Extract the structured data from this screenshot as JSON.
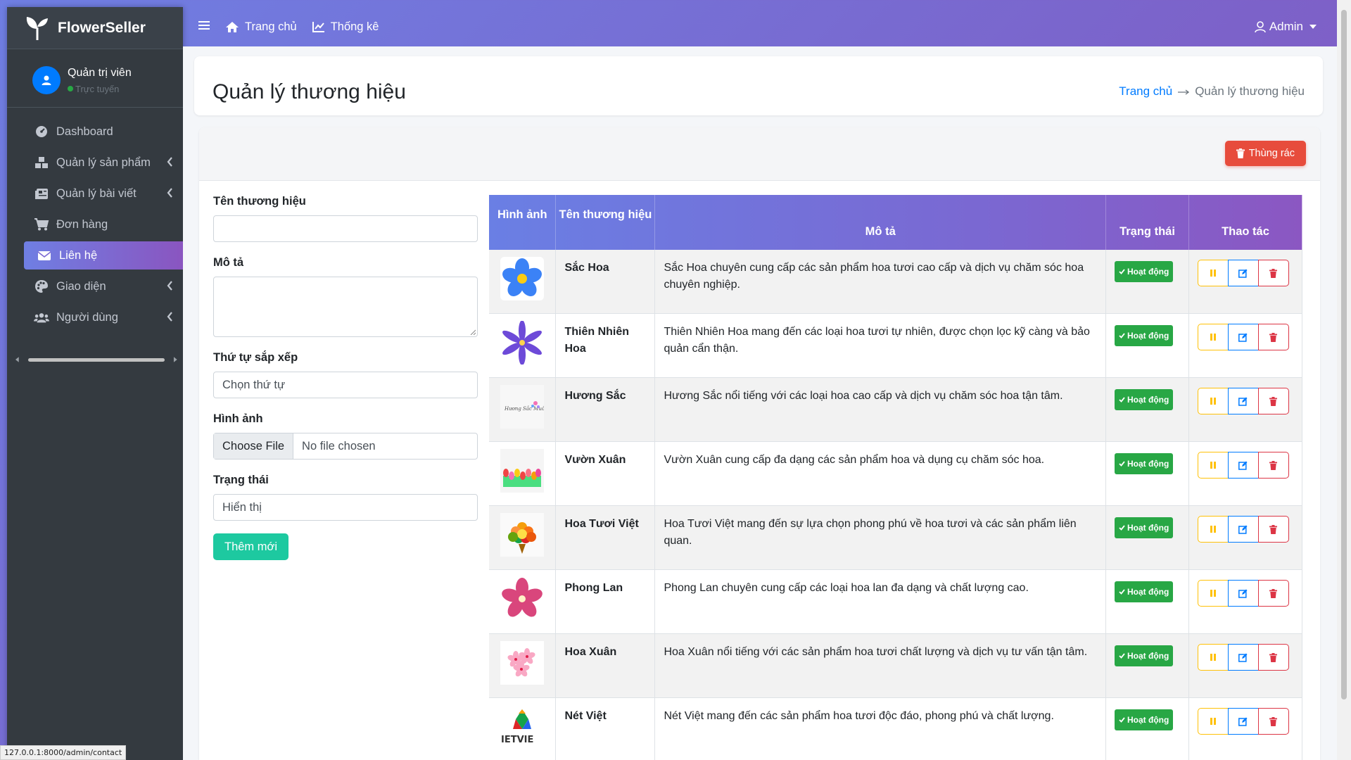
{
  "app": {
    "brand": "FlowerSeller"
  },
  "user": {
    "name": "Quản trị viên",
    "status": "Trực tuyến"
  },
  "sidebar": {
    "items": [
      {
        "label": "Dashboard"
      },
      {
        "label": "Quản lý sản phẩm"
      },
      {
        "label": "Quản lý bài viết"
      },
      {
        "label": "Đơn hàng"
      },
      {
        "label": "Liên hệ"
      },
      {
        "label": "Giao diện"
      },
      {
        "label": "Người dùng"
      }
    ]
  },
  "topnav": {
    "home": "Trang chủ",
    "stats": "Thống kê",
    "admin": "Admin"
  },
  "page": {
    "title": "Quản lý thương hiệu",
    "breadcrumb_home": "Trang chủ",
    "breadcrumb_current": "Quản lý thương hiệu"
  },
  "toolbar": {
    "trash": "Thùng rác"
  },
  "form": {
    "name_label": "Tên thương hiệu",
    "desc_label": "Mô tả",
    "order_label": "Thứ tự sắp xếp",
    "order_value": "Chọn thứ tự",
    "image_label": "Hình ảnh",
    "file_button": "Choose File",
    "file_text": "No file chosen",
    "status_label": "Trạng thái",
    "status_value": "Hiển thị",
    "submit": "Thêm mới"
  },
  "table": {
    "headers": [
      "Hình ảnh",
      "Tên thương hiệu",
      "Mô tả",
      "Trạng thái",
      "Thao tác"
    ],
    "rows": [
      {
        "name": "Sắc Hoa",
        "desc": "Sắc Hoa chuyên cung cấp các sản phẩm hoa tươi cao cấp và dịch vụ chăm sóc hoa chuyên nghiệp.",
        "status": "Hoạt động",
        "thumb": "blue-flower"
      },
      {
        "name": "Thiên Nhiên Hoa",
        "desc": "Thiên Nhiên Hoa mang đến các loại hoa tươi tự nhiên, được chọn lọc kỹ càng và bảo quản cẩn thận.",
        "status": "Hoạt động",
        "thumb": "purple-flower"
      },
      {
        "name": "Hương Sắc",
        "desc": "Hương Sắc nổi tiếng với các loại hoa cao cấp và dịch vụ chăm sóc hoa tận tâm.",
        "status": "Hoạt động",
        "thumb": "huong-sac-logo",
        "logo_text": "Hương Sắc Muôn Tây"
      },
      {
        "name": "Vườn Xuân",
        "desc": "Vườn Xuân cung cấp đa dạng các sản phẩm hoa và dụng cụ chăm sóc hoa.",
        "status": "Hoạt động",
        "thumb": "tulips"
      },
      {
        "name": "Hoa Tươi Việt",
        "desc": "Hoa Tươi Việt mang đến sự lựa chọn phong phú về hoa tươi và các sản phẩm liên quan.",
        "status": "Hoạt động",
        "thumb": "bouquet"
      },
      {
        "name": "Phong Lan",
        "desc": "Phong Lan chuyên cung cấp các loại hoa lan đa dạng và chất lượng cao.",
        "status": "Hoạt động",
        "thumb": "orchid"
      },
      {
        "name": "Hoa Xuân",
        "desc": "Hoa Xuân nổi tiếng với các sản phẩm hoa tươi chất lượng và dịch vụ tư vấn tận tâm.",
        "status": "Hoạt động",
        "thumb": "pink-blossom"
      },
      {
        "name": "Nét Việt",
        "desc": "Nét Việt mang đến các sản phẩm hoa tươi độc đáo, phong phú và chất lượng.",
        "status": "Hoạt động",
        "thumb": "netviet-logo",
        "logo_text": "IETVIE"
      }
    ]
  },
  "statusbar": {
    "url": "127.0.0.1:8000/admin/contact"
  },
  "colors": {
    "accent_start": "#6f7fe3",
    "accent_end": "#8a55c0",
    "sidebar_bg": "#343a40",
    "success": "#28a745",
    "danger": "#e74c3c",
    "teal": "#1dc9a0"
  }
}
